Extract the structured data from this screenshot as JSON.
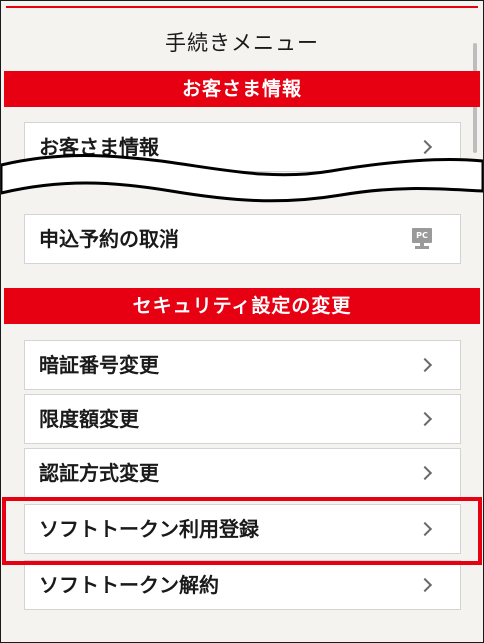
{
  "menu": {
    "title": "手続きメニュー"
  },
  "sections": [
    {
      "header": "お客さま情報",
      "items": [
        {
          "label": "お客さま情報",
          "icon": "chevron-right-icon"
        },
        {
          "label": "申込予約の取消",
          "icon": "pc-icon"
        }
      ]
    },
    {
      "header": "セキュリティ設定の変更",
      "items": [
        {
          "label": "暗証番号変更",
          "icon": "chevron-right-icon"
        },
        {
          "label": "限度額変更",
          "icon": "chevron-right-icon"
        },
        {
          "label": "認証方式変更",
          "icon": "chevron-right-icon"
        },
        {
          "label": "ソフトトークン利用登録",
          "icon": "chevron-right-icon"
        },
        {
          "label": "ソフトトークン解約",
          "icon": "chevron-right-icon"
        }
      ]
    }
  ],
  "pc_icon_text": "PC",
  "colors": {
    "accent": "#e60012",
    "background": "#f4f3f0",
    "item_background": "#ffffff",
    "chevron": "#6a6a6a"
  }
}
